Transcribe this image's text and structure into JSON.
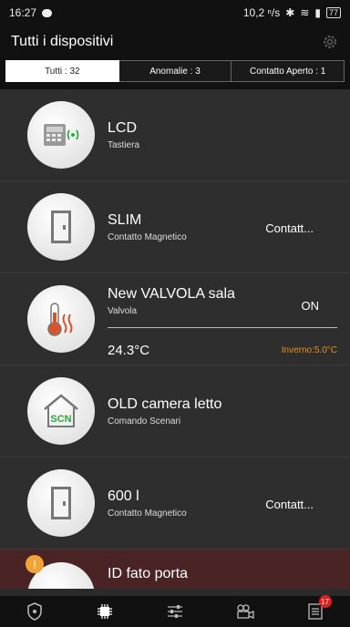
{
  "status_bar": {
    "time": "16:27",
    "speed": "10,2 ⁿ/s",
    "battery": "77"
  },
  "header": {
    "title": "Tutti i dispositivi",
    "settings_icon": "gear-icon"
  },
  "tabs": [
    {
      "label": "Tutti : 32",
      "active": true
    },
    {
      "label": "Anomalie : 3",
      "active": false
    },
    {
      "label": "Contatto Aperto : 1",
      "active": false
    }
  ],
  "devices": [
    {
      "name": "LCD",
      "type": "Tastiera",
      "state": "",
      "icon": "keypad-icon"
    },
    {
      "name": "SLIM",
      "type": "Contatto Magnetico",
      "state": "Contatt...",
      "icon": "door-contact-icon"
    },
    {
      "name": "New VALVOLA sala",
      "type": "Valvola",
      "state": "ON",
      "temperature": "24.3°C",
      "mode": "Inverno:5.0°C",
      "icon": "thermometer-icon"
    },
    {
      "name": "OLD camera letto",
      "type": "Comando Scenari",
      "state": "",
      "icon": "scn-house-icon",
      "icon_text": "SCN"
    },
    {
      "name": "600 l",
      "type": "Contatto Magnetico",
      "state": "Contatt...",
      "icon": "door-contact-icon"
    },
    {
      "name": "ID fato porta",
      "type": "",
      "state": "",
      "icon": "alarm-device-icon",
      "alert": "!"
    }
  ],
  "bottom_nav": [
    {
      "icon": "shield-icon"
    },
    {
      "icon": "chip-icon"
    },
    {
      "icon": "sliders-icon"
    },
    {
      "icon": "camera-icon"
    },
    {
      "icon": "list-icon",
      "badge": "17"
    }
  ],
  "colors": {
    "background": "#2b2b2b",
    "bar": "#111111",
    "accent_orange": "#e8901a",
    "alert_red": "#e02020",
    "alarm_row": "#4a2424"
  }
}
